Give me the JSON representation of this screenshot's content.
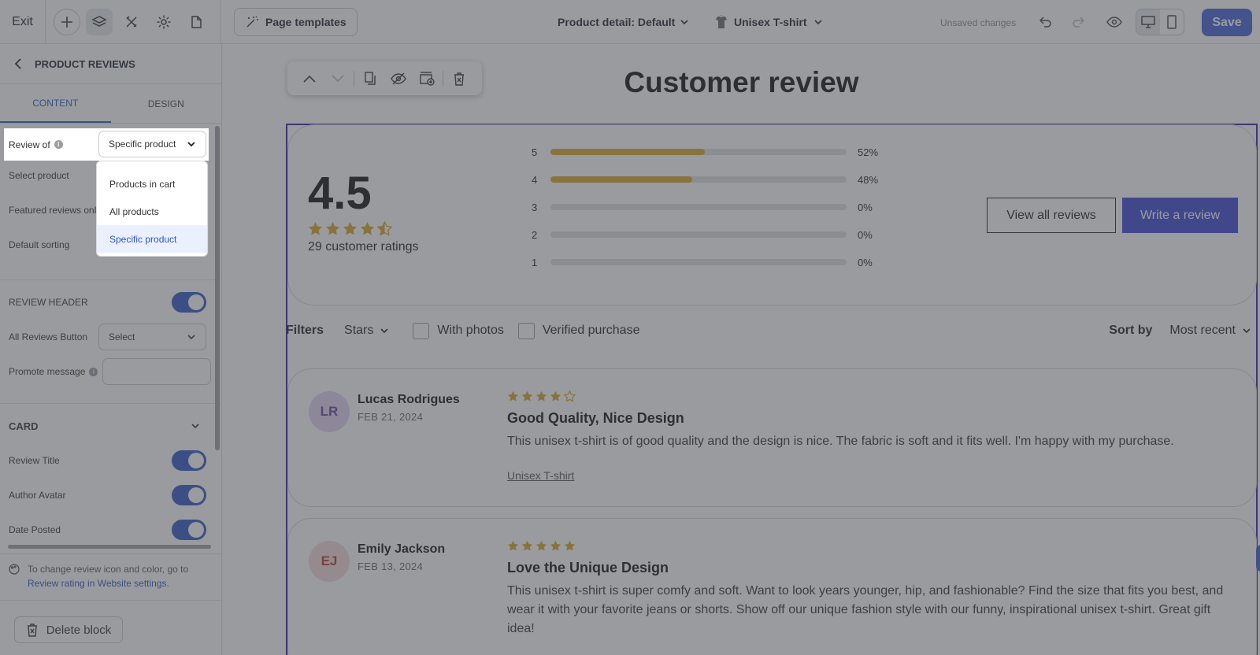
{
  "topbar": {
    "exit": "Exit",
    "page_templates": "Page templates",
    "page_menu": "Product detail: Default",
    "product_menu": "Unisex T-shirt",
    "unsaved": "Unsaved changes",
    "save": "Save"
  },
  "sidebar": {
    "title": "PRODUCT REVIEWS",
    "tabs": [
      "CONTENT",
      "DESIGN"
    ],
    "review_of_label": "Review of",
    "review_of_value": "Specific product",
    "options": [
      "Products in cart",
      "All products",
      "Specific product"
    ],
    "select_product_label": "Select product",
    "featured_label": "Featured reviews only",
    "default_sorting_label": "Default sorting",
    "review_header_label": "REVIEW HEADER",
    "all_reviews_button_label": "All Reviews Button",
    "all_reviews_button_value": "Select",
    "promote_message_label": "Promote message",
    "card_label": "CARD",
    "review_title_label": "Review Title",
    "author_avatar_label": "Author Avatar",
    "date_posted_label": "Date Posted",
    "hint_text": "To change review icon and color, go to",
    "hint_link": "Review rating in Website settings.",
    "delete_block": "Delete block"
  },
  "canvas": {
    "heading": "Customer review",
    "average": "4.5",
    "ratings_count": "29 customer ratings",
    "breakdown": [
      {
        "star": "5",
        "pct": "52%",
        "fill": 0.52
      },
      {
        "star": "4",
        "pct": "48%",
        "fill": 0.48
      },
      {
        "star": "3",
        "pct": "0%",
        "fill": 0
      },
      {
        "star": "2",
        "pct": "0%",
        "fill": 0
      },
      {
        "star": "1",
        "pct": "0%",
        "fill": 0
      }
    ],
    "view_all": "View all reviews",
    "write_review": "Write a review",
    "filters_label": "Filters",
    "stars_filter": "Stars",
    "with_photos": "With photos",
    "verified": "Verified purchase",
    "sort_by_label": "Sort by",
    "sort_value": "Most recent",
    "reviews": [
      {
        "initials": "LR",
        "author": "Lucas Rodrigues",
        "date": "FEB 21, 2024",
        "rating": 4,
        "title": "Good Quality, Nice Design",
        "body": "This unisex t-shirt is of good quality and the design is nice. The fabric is soft and it fits well. I'm happy with my purchase.",
        "product": "Unisex T-shirt"
      },
      {
        "initials": "EJ",
        "author": "Emily Jackson",
        "date": "FEB 13, 2024",
        "rating": 5,
        "title": "Love the Unique Design",
        "body": "This unisex t-shirt is super comfy and soft. Want to look years younger, hip, and fashionable? Find the size that fits you best, and wear it with your favorite jeans or shorts. Show off our unique fashion style with our funny, inspirational unisex t-shirt. Great gift idea!"
      }
    ]
  },
  "colors": {
    "accent": "#4361d8",
    "star": "#d9a629",
    "write_btn": "#3b47d6",
    "selection": "#3b1fa6"
  }
}
